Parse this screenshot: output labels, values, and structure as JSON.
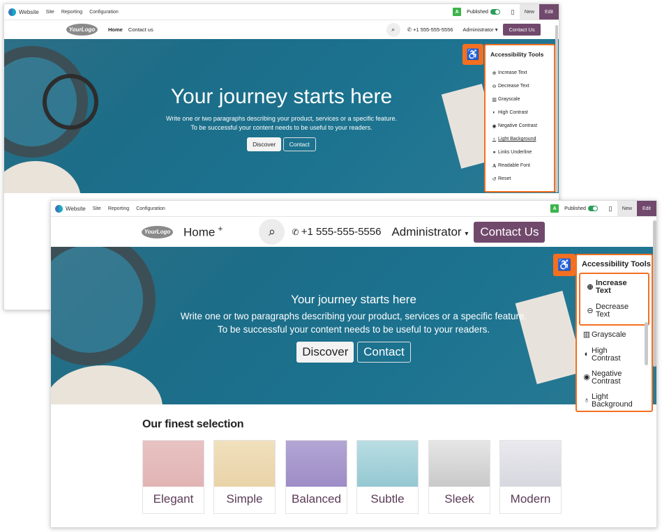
{
  "topbar": {
    "app": "Website",
    "menu": [
      "Site",
      "Reporting",
      "Configuration"
    ],
    "badge": "A",
    "published": "Published",
    "new": "New",
    "edit": "Edit"
  },
  "nav": {
    "logo": "YourLogo",
    "home": "Home",
    "contact_us_link": "Contact us",
    "plus": "+",
    "phone": "+1 555-555-5556",
    "admin": "Administrator",
    "cta": "Contact Us"
  },
  "hero": {
    "title": "Your journey starts here",
    "line1": "Write one or two paragraphs describing your product, services or a specific feature.",
    "line2": "To be successful your content needs to be useful to your readers.",
    "discover": "Discover",
    "contact": "Contact"
  },
  "a11y1": {
    "title": "Accessibility Tools",
    "items": [
      "Increase Text",
      "Decrease Text",
      "Grayscale",
      "High Contrast",
      "Negative Contrast",
      "Light Background",
      "Links Underline",
      "Readable Font",
      "Reset"
    ]
  },
  "a11y2": {
    "title": "Accessibility Tools",
    "increase": "Increase Text",
    "decrease": "Decrease Text",
    "grayscale": "Grayscale",
    "high_contrast": "High Contrast",
    "negative_contrast": "Negative Contrast",
    "light_background": "Light Background"
  },
  "section": {
    "title": "Our finest selection",
    "cards": [
      "Elegant",
      "Simple",
      "Balanced",
      "Subtle",
      "Sleek",
      "Modern"
    ]
  },
  "colors": {
    "brand": "#71496c",
    "accent": "#f37021",
    "published": "#2a9d59"
  }
}
